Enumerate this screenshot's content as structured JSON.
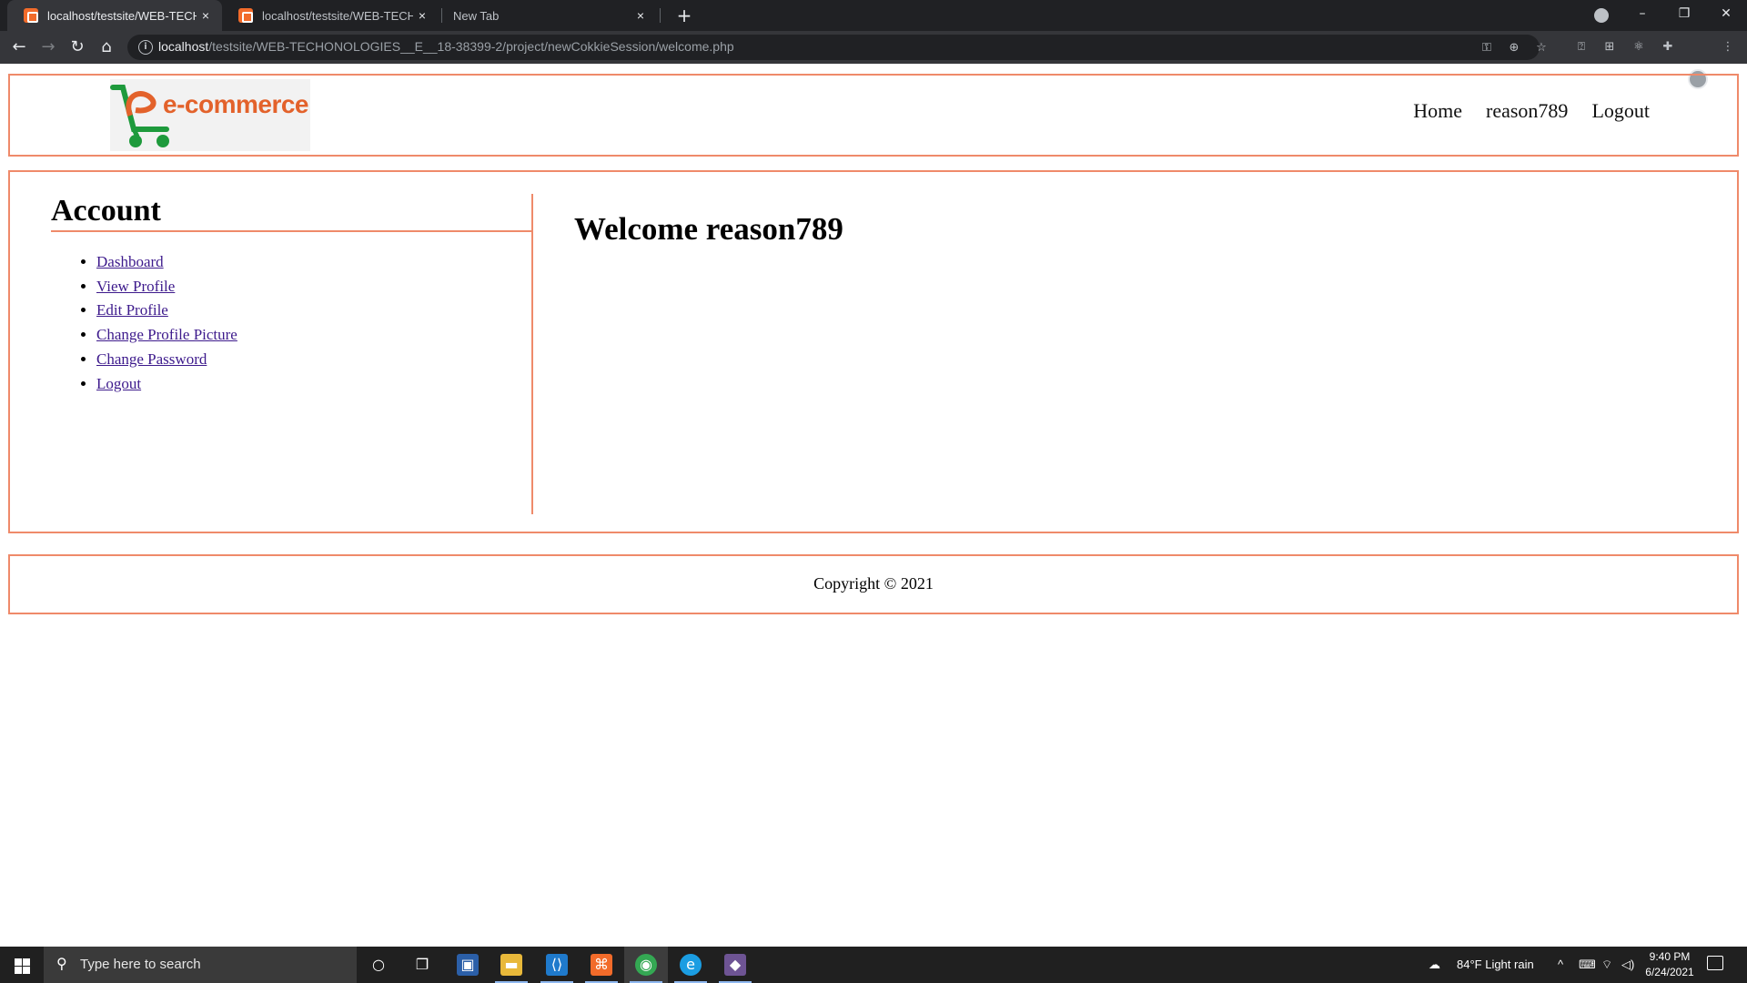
{
  "browser": {
    "tabs": [
      {
        "title": "localhost/testsite/WEB-TECHON",
        "active": true
      },
      {
        "title": "localhost/testsite/WEB-TECHON",
        "active": false
      },
      {
        "title": "New Tab",
        "active": false
      }
    ],
    "close_glyph": "×",
    "new_tab_glyph": "+",
    "url_host": "localhost",
    "url_path": "/testsite/WEB-TECHONOLOGIES__E__18-38399-2/project/newCokkieSession/welcome.php"
  },
  "site": {
    "logo_text": "e-commerce",
    "nav": {
      "home": "Home",
      "user": "reason789",
      "logout": "Logout"
    },
    "sidebar": {
      "title": "Account",
      "links": [
        "Dashboard",
        "View Profile",
        "Edit Profile",
        "Change Profile Picture",
        "Change Password",
        "Logout"
      ]
    },
    "welcome": "Welcome reason789",
    "footer": "Copyright © 2021"
  },
  "taskbar": {
    "search_placeholder": "Type here to search",
    "weather": "84°F  Light rain",
    "time": "9:40 PM",
    "date": "6/24/2021",
    "apps": [
      "cortana-icon",
      "task-view-icon",
      "store-icon",
      "file-explorer-icon",
      "vscode-icon",
      "xampp-icon",
      "chrome-icon",
      "edge-icon",
      "git-icon"
    ]
  },
  "colors": {
    "border_accent": "#ef8a6a",
    "logo_orange": "#e3622b",
    "logo_green": "#1e9a3c",
    "link": "#3d1a8c"
  }
}
